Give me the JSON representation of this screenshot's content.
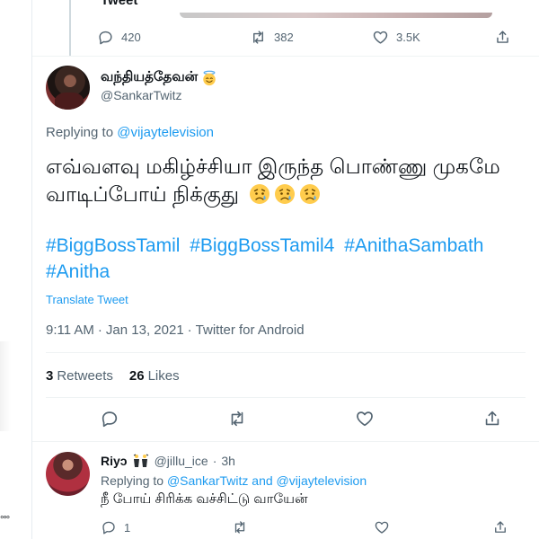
{
  "previous_tweet": {
    "title_fragment": "Tweet",
    "actions": {
      "replies": "420",
      "retweets": "382",
      "likes": "3.5K"
    }
  },
  "tweet": {
    "display_name": "வந்தியத்தேவன்",
    "name_badge_icon": "smiling-face-with-halo-emoji",
    "handle": "@SankarTwitz",
    "replying_label": "Replying to",
    "replying_to": "@vijaytelevision",
    "text": "எவ்வளவு மகிழ்ச்சியா இருந்த பொண்ணு முகமே வாடிப்போய் நிக்குது",
    "text_emoji_icons": [
      "sad-but-relieved-face-emoji",
      "sad-but-relieved-face-emoji",
      "sad-but-relieved-face-emoji"
    ],
    "hashtags": [
      "#BiggBossTamil",
      "#BiggBossTamil4",
      "#AnithaSambath",
      "#Anitha"
    ],
    "translate_label": "Translate Tweet",
    "time": "9:11 AM",
    "date": "Jan 13, 2021",
    "separator": "·",
    "source": "Twitter for Android",
    "retweets_count": "3",
    "retweets_label": "Retweets",
    "likes_count": "26",
    "likes_label": "Likes"
  },
  "reply": {
    "display_name": "Riyↄ",
    "name_emoji_icon": "dancers-emoji",
    "handle": "@jillu_ice",
    "separator": "·",
    "age": "3h",
    "replying_label": "Replying to",
    "replying_to_1": "@SankarTwitz",
    "and_label": "and",
    "replying_to_2": "@vijaytelevision",
    "text": "நீ போய் சிரிக்க வச்சிட்டு வாயேன்",
    "replies": "1"
  },
  "gutter": {
    "dots": "°°°"
  },
  "colors": {
    "accent": "#1d9bf0",
    "muted": "#536471",
    "text": "#0f1419",
    "divider": "#eff3f4"
  }
}
